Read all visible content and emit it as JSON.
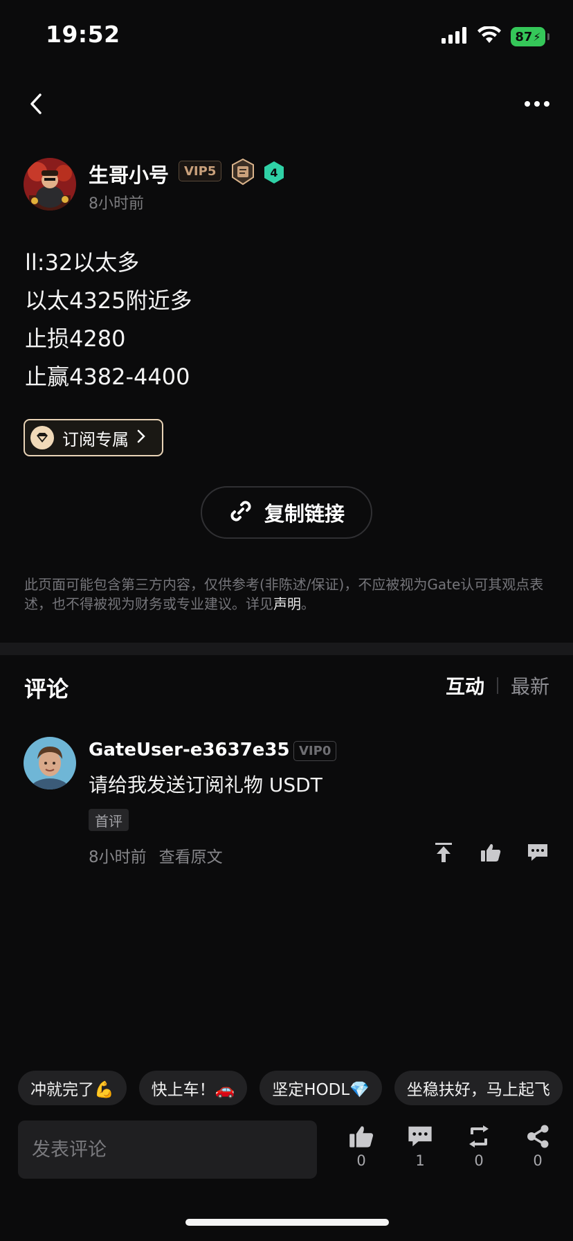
{
  "status_bar": {
    "time": "19:52",
    "battery": "87"
  },
  "author": {
    "name": "生哥小号",
    "vip": "VIP5",
    "level": "4",
    "time": "8小时前"
  },
  "post": {
    "lines": [
      "ll:32以太多",
      "以太4325附近多",
      "止损4280",
      "止赢4382-4400"
    ],
    "subscribe_label": "订阅专属",
    "copy_link_label": "复制链接"
  },
  "disclaimer": {
    "text": "此页面可能包含第三方内容，仅供参考(非陈述/保证)，不应被视为Gate认可其观点表述，也不得被视为财务或专业建议。详见",
    "link": "声明",
    "end": "。"
  },
  "comments": {
    "title": "评论",
    "tab_active": "互动",
    "tab_inactive": "最新",
    "items": [
      {
        "user": "GateUser-e3637e35",
        "vip": "VIP0",
        "text": "请给我发送订阅礼物 USDT",
        "tag": "首评",
        "time": "8小时前",
        "view_original": "查看原文"
      }
    ]
  },
  "quick_replies": [
    "冲就完了💪",
    "快上车！🚗",
    "坚定HODL💎",
    "坐稳扶好，马上起飞"
  ],
  "composer": {
    "placeholder": "发表评论"
  },
  "bottom_actions": {
    "likes": "0",
    "comments": "1",
    "reposts": "0",
    "shares": "0"
  }
}
